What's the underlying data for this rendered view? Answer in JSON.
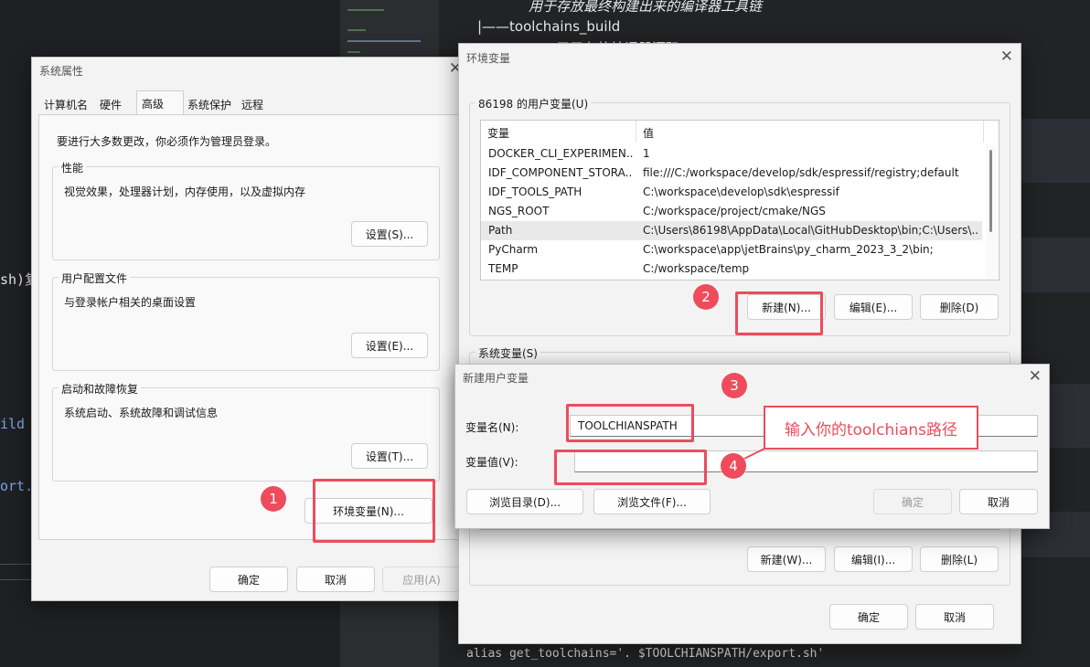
{
  "background": {
    "doc_line1": "用于存放最终构建出来的编译器工具链",
    "doc_line2": "|——toolchains_build",
    "doc_line3": "——用于存放编译器源码",
    "left_frag1": "sh)复",
    "left_frag2": "ild",
    "left_frag3": "ort.",
    "bottom_code": "alias get_toolchains='. $TOOLCHIANSPATH/export.sh'"
  },
  "sysprops": {
    "title": "系统属性",
    "tabs": [
      "计算机名",
      "硬件",
      "高级",
      "系统保护",
      "远程"
    ],
    "admin_note": "要进行大多数更改，你必须作为管理员登录。",
    "performance": {
      "title": "性能",
      "desc": "视觉效果，处理器计划，内存使用，以及虚拟内存",
      "button": "设置(S)..."
    },
    "profile": {
      "title": "用户配置文件",
      "desc": "与登录帐户相关的桌面设置",
      "button": "设置(E)..."
    },
    "startup": {
      "title": "启动和故障恢复",
      "desc": "系统启动、系统故障和调试信息",
      "button": "设置(T)..."
    },
    "env_button": "环境变量(N)...",
    "ok": "确定",
    "cancel": "取消",
    "apply": "应用(A)"
  },
  "envvars": {
    "title": "环境变量",
    "user_group": "86198 的用户变量(U)",
    "columns": [
      "变量",
      "值"
    ],
    "rows": [
      {
        "name": "DOCKER_CLI_EXPERIMEN...",
        "value": "1"
      },
      {
        "name": "IDF_COMPONENT_STORA...",
        "value": "file:///C:/workspace/develop/sdk/espressif/registry;default"
      },
      {
        "name": "IDF_TOOLS_PATH",
        "value": "C:\\workspace\\develop\\sdk\\espressif"
      },
      {
        "name": "NGS_ROOT",
        "value": "C:/workspace/project/cmake/NGS"
      },
      {
        "name": "Path",
        "value": "C:\\Users\\86198\\AppData\\Local\\GitHubDesktop\\bin;C:\\Users\\..."
      },
      {
        "name": "PyCharm",
        "value": "C:\\workspace\\app\\jetBrains\\py_charm_2023_3_2\\bin;"
      },
      {
        "name": "TEMP",
        "value": "C:/workspace/temp"
      }
    ],
    "user_new": "新建(N)...",
    "user_edit": "编辑(E)...",
    "user_delete": "删除(D)",
    "sys_group": "系统变量(S)",
    "sys_new": "新建(W)...",
    "sys_edit": "编辑(I)...",
    "sys_delete": "删除(L)",
    "ok": "确定",
    "cancel": "取消"
  },
  "newvar": {
    "title": "新建用户变量",
    "name_label": "变量名(N):",
    "name_value": "TOOLCHIANSPATH",
    "value_label": "变量值(V):",
    "value_value": "",
    "browse_dir": "浏览目录(D)...",
    "browse_file": "浏览文件(F)...",
    "ok": "确定",
    "cancel": "取消"
  },
  "annotations": {
    "badges": [
      "1",
      "2",
      "3",
      "4"
    ],
    "callout": "输入你的toolchians路径",
    "color": "#ec4c5d"
  }
}
